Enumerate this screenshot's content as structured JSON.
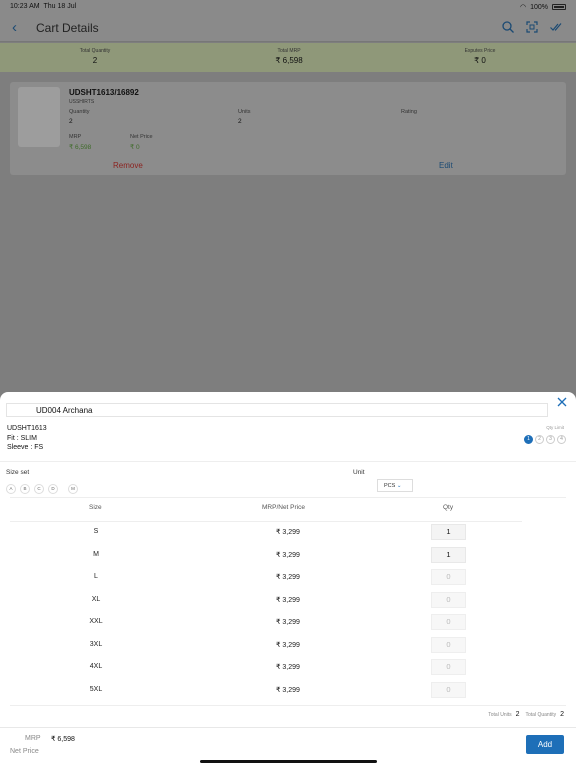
{
  "status": {
    "time": "10:23 AM",
    "date": "Thu 18 Jul",
    "battery": "100%"
  },
  "nav": {
    "title": "Cart Details"
  },
  "summary": [
    {
      "label": "Total Quantity",
      "value": "2"
    },
    {
      "label": "Total MRP",
      "value": "₹ 6,598"
    },
    {
      "label": "Exputes Price",
      "value": "₹ 0"
    }
  ],
  "card": {
    "code": "UDSHT1613/16892",
    "category": "USSHIRTS",
    "quantity_label": "Quantity",
    "quantity": "2",
    "units_label": "Units",
    "units": "2",
    "rating_label": "Rating",
    "mrp_label": "MRP",
    "mrp": "₹ 6,598",
    "net_label": "Net Price",
    "net": "₹ 0",
    "remove": "Remove",
    "edit": "Edit"
  },
  "sheet": {
    "customer": "UD004 Archana",
    "item_code": "UDSHT1613",
    "fit": "Fit : SLIM",
    "sleeve": "Sleeve : FS",
    "qty_limit_label": "Qty Limit",
    "qty_limit_steps": [
      "1",
      "2",
      "3",
      "4"
    ],
    "size_set_label": "Size set",
    "size_sets": [
      "A",
      "B",
      "C",
      "D",
      "M"
    ],
    "unit_label": "Unit",
    "unit_value": "PCS",
    "headers": {
      "size": "Size",
      "price": "MRP/Net Price",
      "qty": "Qty"
    },
    "rows": [
      {
        "size": "S",
        "price": "₹ 3,299",
        "qty": "1"
      },
      {
        "size": "M",
        "price": "₹ 3,299",
        "qty": "1"
      },
      {
        "size": "L",
        "price": "₹ 3,299",
        "qty": "0"
      },
      {
        "size": "XL",
        "price": "₹ 3,299",
        "qty": "0"
      },
      {
        "size": "XXL",
        "price": "₹ 3,299",
        "qty": "0"
      },
      {
        "size": "3XL",
        "price": "₹ 3,299",
        "qty": "0"
      },
      {
        "size": "4XL",
        "price": "₹ 3,299",
        "qty": "0"
      },
      {
        "size": "5XL",
        "price": "₹ 3,299",
        "qty": "0"
      }
    ],
    "total_units_label": "Total Units",
    "total_units": "2",
    "total_qty_label": "Total Quantity",
    "total_qty": "2"
  },
  "footer": {
    "mrp_label": "MRP",
    "mrp": "₹ 6,598",
    "net_label": "Net Price",
    "add": "Add"
  },
  "colors": {
    "accent": "#1e6fb8",
    "remove": "#c0392b",
    "price_green": "#3f8a2a"
  }
}
